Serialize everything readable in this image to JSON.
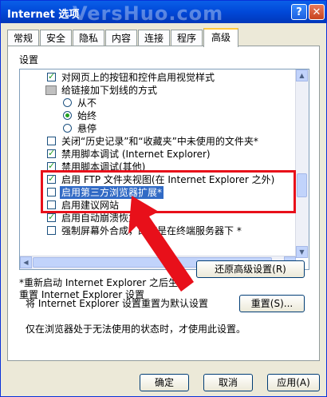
{
  "window": {
    "title": "Internet 选项",
    "watermark": "VersHuo.com",
    "help_symbol": "?",
    "close_symbol": "✕"
  },
  "tabs": [
    {
      "label": "常规"
    },
    {
      "label": "安全"
    },
    {
      "label": "隐私"
    },
    {
      "label": "内容"
    },
    {
      "label": "连接"
    },
    {
      "label": "程序"
    },
    {
      "label": "高级"
    }
  ],
  "settings": {
    "group_label": "设置",
    "items": [
      {
        "type": "checkbox",
        "checked": true,
        "text": "对网页上的按钮和控件启用视觉样式"
      },
      {
        "type": "folder",
        "text": "给链接加下划线的方式"
      },
      {
        "type": "radio",
        "checked": false,
        "text": "从不"
      },
      {
        "type": "radio",
        "checked": true,
        "text": "始终"
      },
      {
        "type": "radio",
        "checked": false,
        "text": "悬停"
      },
      {
        "type": "checkbox",
        "checked": false,
        "text": "关闭“历史记录”和“收藏夹”中未使用的文件夹*"
      },
      {
        "type": "checkbox",
        "checked": true,
        "text": "禁用脚本调试 (Internet Explorer)"
      },
      {
        "type": "checkbox",
        "checked": true,
        "text": "禁用脚本调试(其他)"
      },
      {
        "type": "checkbox",
        "checked": true,
        "text": "启用 FTP 文件夹视图(在 Internet Explorer 之外)"
      },
      {
        "type": "checkbox",
        "checked": false,
        "text": "启用第三方浏览器扩展*",
        "selected": true
      },
      {
        "type": "checkbox",
        "checked": false,
        "text": "启用建议网站"
      },
      {
        "type": "checkbox",
        "checked": true,
        "text": "启用自动崩溃恢复"
      },
      {
        "type": "checkbox",
        "checked": false,
        "text": "强制屏幕外合成，即使是在终端服务器下 *"
      }
    ],
    "restart_note": "*重新启动 Internet Explorer 之后生效",
    "restore_button": "还原高级设置(R)"
  },
  "reset": {
    "group_label": "重置 Internet Explorer 设置",
    "line_text": "将 Internet Explorer 设置重置为默认设置",
    "reset_button": "重置(S)...",
    "note": "仅在浏览器处于无法使用的状态时，才使用此设置。"
  },
  "footer": {
    "ok": "确定",
    "cancel": "取消",
    "apply": "应用(A)"
  },
  "colors": {
    "annotation_red": "#e8101a",
    "title_blue": "#0148d8",
    "selection": "#316ac5"
  }
}
